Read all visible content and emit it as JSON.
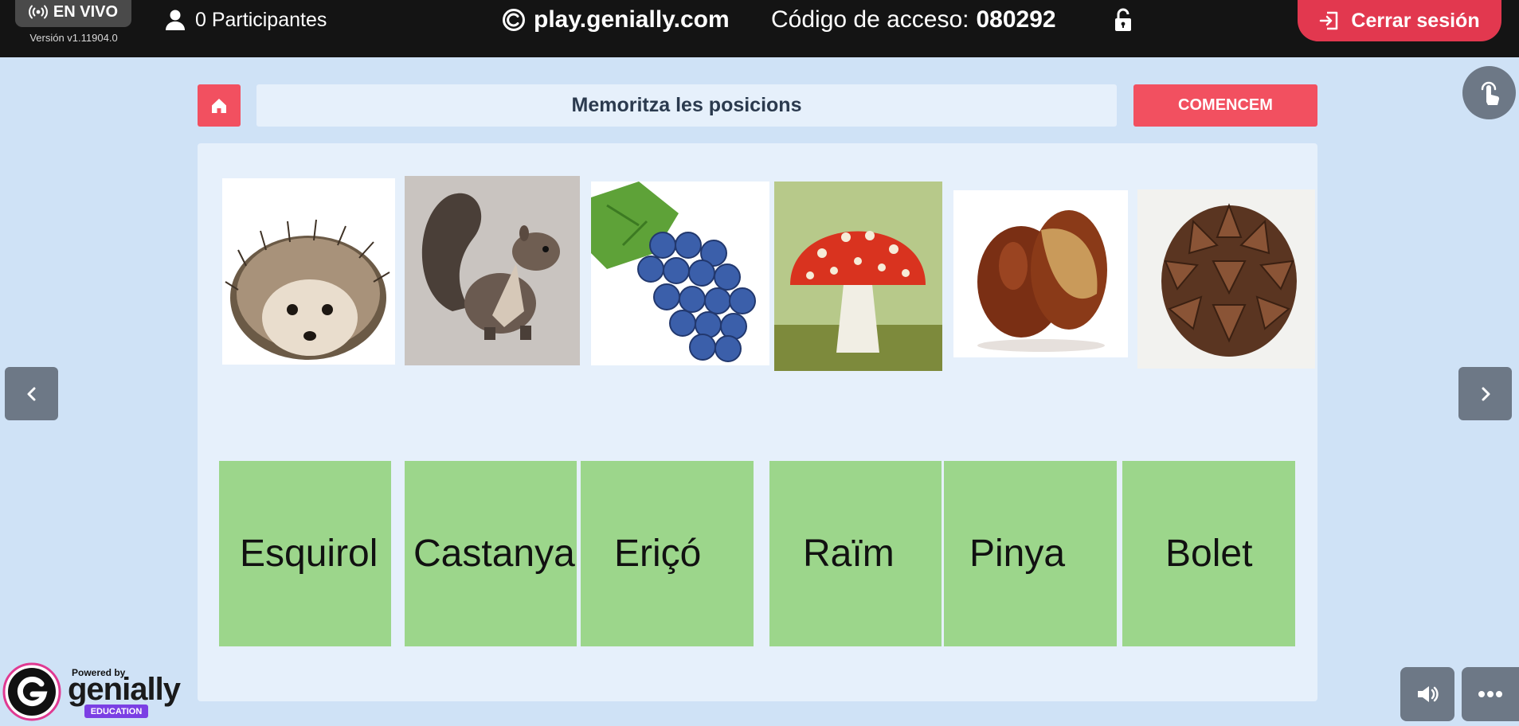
{
  "topbar": {
    "live_label": "EN VIVO",
    "version": "Versión v1.11904.0",
    "participants": "0 Participantes",
    "site": "play.genially.com",
    "access_label": "Código de acceso:",
    "access_code": "080292",
    "logout_label": "Cerrar sesión",
    "logout_color": "#e2384f"
  },
  "header": {
    "title": "Memoritza les posicions",
    "start_label": "COMENCEM",
    "accent": "#f25060"
  },
  "images": [
    {
      "name": "hedgehog",
      "icon": "hedgehog-image"
    },
    {
      "name": "squirrel",
      "icon": "squirrel-image"
    },
    {
      "name": "grapes",
      "icon": "grapes-image"
    },
    {
      "name": "mushroom",
      "icon": "mushroom-image"
    },
    {
      "name": "chestnut",
      "icon": "chestnut-image"
    },
    {
      "name": "pinecone",
      "icon": "pinecone-image"
    }
  ],
  "words": [
    "Esquirol",
    "Castanya",
    "Eriçó",
    "Raïm",
    "Pinya",
    "Bolet"
  ],
  "word_card_color": "#9cd68b",
  "branding": {
    "powered": "Powered by",
    "name": "genially",
    "tag": "EDUCATION"
  },
  "icons": [
    "broadcast-icon",
    "user-icon",
    "copyright-icon",
    "unlock-icon",
    "logout-icon",
    "home-icon",
    "chevron-left-icon",
    "chevron-right-icon",
    "touch-icon",
    "speaker-icon",
    "more-icon"
  ]
}
